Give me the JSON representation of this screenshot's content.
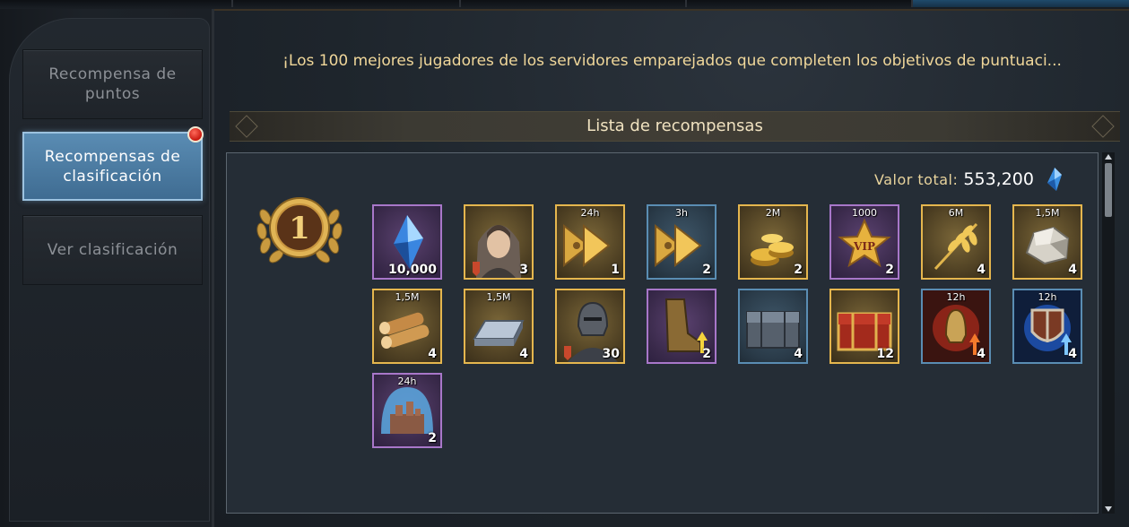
{
  "sidebar": {
    "tabs": [
      {
        "label": "Recompensa de puntos",
        "active": false
      },
      {
        "label": "Recompensas de clasificación",
        "active": true,
        "notification": true
      },
      {
        "label": "Ver clasificación",
        "active": false
      }
    ]
  },
  "headline": "¡Los 100 mejores jugadores de los servidores emparejados que completen los objetivos de puntuaci...",
  "rewards_list": {
    "title": "Lista de recompensas",
    "total_label": "Valor total:",
    "total_value": "553,200",
    "rank": "1",
    "items": [
      {
        "icon": "blue-gem-icon",
        "rarity": "purple",
        "tag": "",
        "count": "10,000"
      },
      {
        "icon": "hooded-hero-icon",
        "rarity": "gold",
        "tag": "",
        "count": "3"
      },
      {
        "icon": "speedup-arrows-icon",
        "rarity": "gold",
        "tag": "24h",
        "count": "1"
      },
      {
        "icon": "speedup-arrows-icon",
        "rarity": "blue",
        "tag": "3h",
        "count": "2"
      },
      {
        "icon": "gold-coins-icon",
        "rarity": "gold",
        "tag": "2M",
        "count": "2"
      },
      {
        "icon": "vip-star-icon",
        "rarity": "purple",
        "tag": "1000",
        "count": "2"
      },
      {
        "icon": "wheat-icon",
        "rarity": "gold",
        "tag": "6M",
        "count": "4"
      },
      {
        "icon": "stone-icon",
        "rarity": "gold",
        "tag": "1,5M",
        "count": "4"
      },
      {
        "icon": "wood-logs-icon",
        "rarity": "gold",
        "tag": "1,5M",
        "count": "4"
      },
      {
        "icon": "iron-ingot-icon",
        "rarity": "gold",
        "tag": "1,5M",
        "count": "4"
      },
      {
        "icon": "armored-soldier-icon",
        "rarity": "gold",
        "tag": "",
        "count": "30"
      },
      {
        "icon": "boot-upgrade-icon",
        "rarity": "purple",
        "tag": "",
        "count": "2"
      },
      {
        "icon": "silver-chest-icon",
        "rarity": "blue",
        "tag": "",
        "count": "4"
      },
      {
        "icon": "red-chest-icon",
        "rarity": "gold",
        "tag": "",
        "count": "12"
      },
      {
        "icon": "attack-boost-icon",
        "rarity": "blue",
        "tag": "12h",
        "count": "4"
      },
      {
        "icon": "defense-boost-icon",
        "rarity": "blue",
        "tag": "12h",
        "count": "4"
      },
      {
        "icon": "city-shield-icon",
        "rarity": "purple",
        "tag": "24h",
        "count": "2"
      }
    ]
  }
}
